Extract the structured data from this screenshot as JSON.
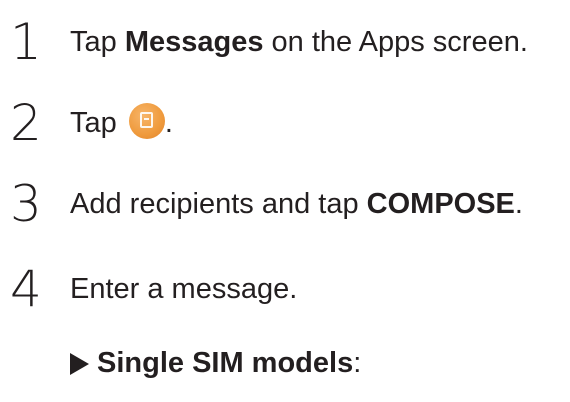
{
  "steps": [
    {
      "number": "1",
      "text_before": "Tap ",
      "bold": "Messages",
      "text_after": " on the Apps screen."
    },
    {
      "number": "2",
      "text_before": "Tap ",
      "icon": "compose-message-icon",
      "text_after": "."
    },
    {
      "number": "3",
      "text_before": "Add recipients and tap ",
      "bold": "COMPOSE",
      "text_after": "."
    },
    {
      "number": "4",
      "text_before": "Enter a message.",
      "bold": "",
      "text_after": ""
    }
  ],
  "substep": {
    "bold": "Single SIM models",
    "text_after": ":"
  },
  "colors": {
    "text": "#231f20",
    "icon_orange": "#ef9a3c"
  }
}
